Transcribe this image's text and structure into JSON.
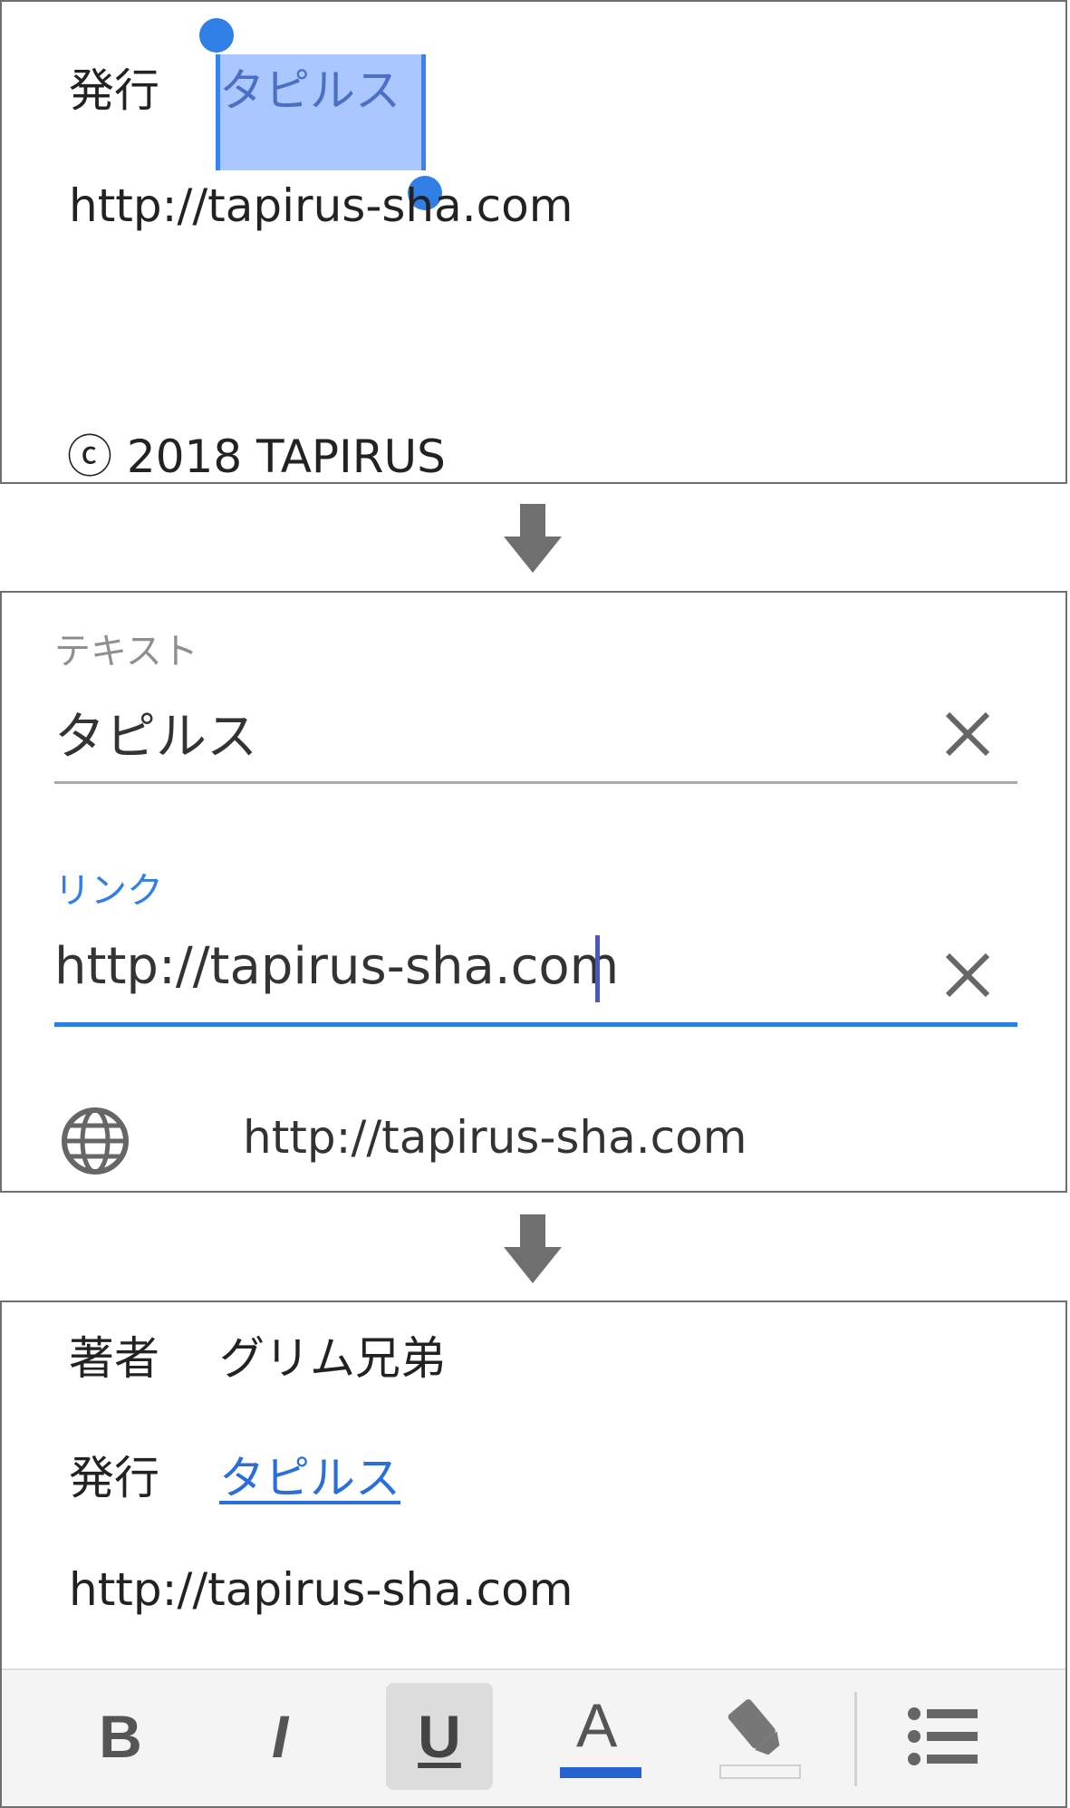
{
  "step1": {
    "publisher_label": "発行",
    "selected_text": "タピルス",
    "url": "http://tapirus-sha.com",
    "copyright": "ⓒ 2018 TAPIRUS"
  },
  "step2": {
    "text_field": {
      "label": "テキスト",
      "value": "タピルス"
    },
    "link_field": {
      "label": "リンク",
      "value": "http://tapirus-sha.com"
    },
    "suggestion": {
      "icon": "globe-icon",
      "url": "http://tapirus-sha.com"
    }
  },
  "step3": {
    "author_label": "著者",
    "author_value": "グリム兄弟",
    "publisher_label": "発行",
    "publisher_link": "タピルス",
    "url": "http://tapirus-sha.com",
    "toolbar": {
      "bold": "B",
      "italic": "I",
      "underline": "U",
      "text_color": "A",
      "text_color_swatch": "#2563d0",
      "highlight_icon": "highlighter-icon",
      "list_icon": "bulleted-list-icon"
    }
  },
  "colors": {
    "accent": "#2f7fe6",
    "link": "#2c6ed8",
    "selection": "#9cbcf8"
  }
}
